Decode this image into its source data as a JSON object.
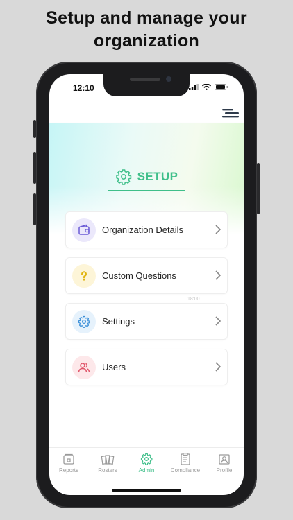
{
  "headline": {
    "line1": "Setup and manage your",
    "line2": "organization"
  },
  "status": {
    "time": "12:10"
  },
  "setup": {
    "title": "SETUP"
  },
  "menu": {
    "items": [
      {
        "label": "Organization Details",
        "icon": "wallet-icon",
        "color": "#6b5bd6"
      },
      {
        "label": "Custom Questions",
        "icon": "question-icon",
        "color": "#e0b40f"
      },
      {
        "label": "Settings",
        "icon": "gear-icon",
        "color": "#3b8fd8"
      },
      {
        "label": "Users",
        "icon": "users-icon",
        "color": "#e0556a"
      }
    ]
  },
  "ghost_time": "18:00",
  "tabs": [
    {
      "label": "Reports",
      "icon": "reports-icon",
      "active": false
    },
    {
      "label": "Rosters",
      "icon": "rosters-icon",
      "active": false
    },
    {
      "label": "Admin",
      "icon": "gear-icon",
      "active": true
    },
    {
      "label": "Compliance",
      "icon": "compliance-icon",
      "active": false
    },
    {
      "label": "Profile",
      "icon": "profile-icon",
      "active": false
    }
  ],
  "colors": {
    "accent": "#3fbf8a",
    "background": "#d9d9d9",
    "phone_frame": "#1c1c1e"
  }
}
